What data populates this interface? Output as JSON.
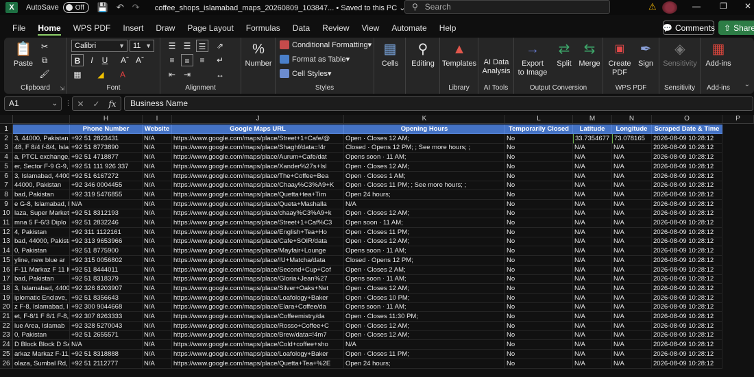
{
  "titlebar": {
    "autosave_label": "AutoSave",
    "toggle_state": "Off",
    "file_name": "coffee_shops_islamabad_maps_20260809_103847...",
    "save_status": "Saved to this PC",
    "search_placeholder": "Search"
  },
  "tabs": [
    "File",
    "Home",
    "WPS PDF",
    "Insert",
    "Draw",
    "Page Layout",
    "Formulas",
    "Data",
    "Review",
    "View",
    "Automate",
    "Help"
  ],
  "active_tab": "Home",
  "buttons": {
    "comments": "Comments",
    "share": "Share"
  },
  "ribbon": {
    "clipboard": {
      "name": "Clipboard",
      "paste": "Paste"
    },
    "font": {
      "name": "Font",
      "family": "Calibri",
      "size": "11"
    },
    "alignment": {
      "name": "Alignment"
    },
    "number": {
      "label": "Number",
      "symbol": "%"
    },
    "styles": {
      "name": "Styles",
      "conditional": "Conditional Formatting",
      "format_table": "Format as Table",
      "cell_styles": "Cell Styles"
    },
    "cells": {
      "label": "Cells"
    },
    "editing": {
      "label": "Editing"
    },
    "library": {
      "name": "Library",
      "templates": "Templates"
    },
    "ai_tools": {
      "name": "AI Tools",
      "ai_data_1": "AI Data",
      "ai_data_2": "Analysis"
    },
    "output": {
      "name": "Output Conversion",
      "export_1": "Export",
      "export_2": "to Image",
      "split": "Split",
      "merge": "Merge"
    },
    "wps_pdf": {
      "name": "WPS PDF",
      "create_1": "Create",
      "create_2": "PDF",
      "sign": "Sign"
    },
    "sensitivity": {
      "name": "Sensitivity",
      "label": "Sensitivity"
    },
    "addins": {
      "name": "Add-ins",
      "label": "Add-ins"
    }
  },
  "formula_bar": {
    "cell_ref": "A1",
    "content": "Business Name"
  },
  "columns": [
    "H",
    "I",
    "J",
    "K",
    "L",
    "M",
    "N",
    "O",
    "P"
  ],
  "headers": [
    "Phone Number",
    "Website",
    "Google Maps URL",
    "Opening Hours",
    "Temporarily Closed",
    "Latitude",
    "Longitude",
    "Scraped Date & Time"
  ],
  "rows": [
    {
      "n": "1"
    },
    {
      "n": "2",
      "g": "3, 44000, Pakistan",
      "h": "+92 51 2823431",
      "i": "N/A",
      "j": "https://www.google.com/maps/place/Street+1+Cafe/@",
      "k": "Open · Closes 12 AM;",
      "l": "No",
      "m": "33.7354677",
      "nv": "73.078165",
      "o": "2026-08-09 10:28:12"
    },
    {
      "n": "3",
      "g": "48, F 8/4 f-8/4, Isla",
      "h": "+92 51 8773890",
      "i": "N/A",
      "j": "https://www.google.com/maps/place/Shaghf/data=!4r",
      "k": "Closed · Opens 12 PM; ; See more hours; ;",
      "l": "No",
      "m": "N/A",
      "nv": "N/A",
      "o": "2026-08-09 10:28:12"
    },
    {
      "n": "4",
      "g": "a, PTCL exchange, S",
      "h": "+92 51 4718877",
      "i": "N/A",
      "j": "https://www.google.com/maps/place/Aurum+Cafe/dat",
      "k": "Opens soon · 11 AM;",
      "l": "No",
      "m": "N/A",
      "nv": "N/A",
      "o": "2026-08-09 10:28:12"
    },
    {
      "n": "5",
      "g": "er, Sector F-9 G-9, I",
      "h": "+92 51 111 926 337",
      "i": "N/A",
      "j": "https://www.google.com/maps/place/Xander%27s+Isl",
      "k": "Open · Closes 12 AM;",
      "l": "No",
      "m": "N/A",
      "nv": "N/A",
      "o": "2026-08-09 10:28:12"
    },
    {
      "n": "6",
      "g": "3, Islamabad, 4400",
      "h": "+92 51 6167272",
      "i": "N/A",
      "j": "https://www.google.com/maps/place/The+Coffee+Bea",
      "k": "Open · Closes 1 AM;",
      "l": "No",
      "m": "N/A",
      "nv": "N/A",
      "o": "2026-08-09 10:28:12"
    },
    {
      "n": "7",
      "g": "44000, Pakistan",
      "h": "+92 346 0004455",
      "i": "N/A",
      "j": "https://www.google.com/maps/place/Chaay%C3%A9+K",
      "k": "Open · Closes 11 PM; ; See more hours; ;",
      "l": "No",
      "m": "N/A",
      "nv": "N/A",
      "o": "2026-08-09 10:28:12"
    },
    {
      "n": "8",
      "g": "bad, Pakistan",
      "h": "+92 319 5476855",
      "i": "N/A",
      "j": "https://www.google.com/maps/place/Quetta+tea+Tim",
      "k": "Open 24 hours;",
      "l": "No",
      "m": "N/A",
      "nv": "N/A",
      "o": "2026-08-09 10:28:12"
    },
    {
      "n": "9",
      "g": "e G-8, Islamabad, F",
      "h": "N/A",
      "i": "N/A",
      "j": "https://www.google.com/maps/place/Queta+Mashalla",
      "k": "N/A",
      "l": "No",
      "m": "N/A",
      "nv": "N/A",
      "o": "2026-08-09 10:28:12"
    },
    {
      "n": "10",
      "g": "laza, Super Market",
      "h": "+92 51 8312193",
      "i": "N/A",
      "j": "https://www.google.com/maps/place/chaay%C3%A9+k",
      "k": "Open · Closes 12 AM;",
      "l": "No",
      "m": "N/A",
      "nv": "N/A",
      "o": "2026-08-09 10:28:12"
    },
    {
      "n": "11",
      "g": "mna 5 F-6/3 Diplo",
      "h": "+92 51 2832246",
      "i": "N/A",
      "j": "https://www.google.com/maps/place/Street+1+Caf%C3",
      "k": "Open soon · 11 AM;",
      "l": "No",
      "m": "N/A",
      "nv": "N/A",
      "o": "2026-08-09 10:28:12"
    },
    {
      "n": "12",
      "g": "4, Pakistan",
      "h": "+92 311 1122161",
      "i": "N/A",
      "j": "https://www.google.com/maps/place/English+Tea+Ho",
      "k": "Open · Closes 11 PM;",
      "l": "No",
      "m": "N/A",
      "nv": "N/A",
      "o": "2026-08-09 10:28:12"
    },
    {
      "n": "13",
      "g": "bad, 44000, Pakista",
      "h": "+92 313 9653966",
      "i": "N/A",
      "j": "https://www.google.com/maps/place/Cafe+SOIR/data",
      "k": "Open · Closes 12 AM;",
      "l": "No",
      "m": "N/A",
      "nv": "N/A",
      "o": "2026-08-09 10:28:12"
    },
    {
      "n": "14",
      "g": "0, Pakistan",
      "h": "+92 51 8775900",
      "i": "N/A",
      "j": "https://www.google.com/maps/place/Mayfair+Lounge",
      "k": "Opens soon · 11 AM;",
      "l": "No",
      "m": "N/A",
      "nv": "N/A",
      "o": "2026-08-09 10:28:12"
    },
    {
      "n": "15",
      "g": "yline, new blue ar",
      "h": "+92 315 0056802",
      "i": "N/A",
      "j": "https://www.google.com/maps/place/IU+Matcha/data",
      "k": "Closed · Opens 12 PM;",
      "l": "No",
      "m": "N/A",
      "nv": "N/A",
      "o": "2026-08-09 10:28:12"
    },
    {
      "n": "16",
      "g": "F-11 Markaz F 11 M",
      "h": "+92 51 8444011",
      "i": "N/A",
      "j": "https://www.google.com/maps/place/Second+Cup+Cof",
      "k": "Open · Closes 2 AM;",
      "l": "No",
      "m": "N/A",
      "nv": "N/A",
      "o": "2026-08-09 10:28:12"
    },
    {
      "n": "17",
      "g": "bad, Pakistan",
      "h": "+92 51 8318379",
      "i": "N/A",
      "j": "https://www.google.com/maps/place/Gloria+Jean%27",
      "k": "Opens soon · 11 AM;",
      "l": "No",
      "m": "N/A",
      "nv": "N/A",
      "o": "2026-08-09 10:28:12"
    },
    {
      "n": "18",
      "g": "3, Islamabad, 4400",
      "h": "+92 326 8203907",
      "i": "N/A",
      "j": "https://www.google.com/maps/place/Silver+Oaks+Net",
      "k": "Open · Closes 12 AM;",
      "l": "No",
      "m": "N/A",
      "nv": "N/A",
      "o": "2026-08-09 10:28:12"
    },
    {
      "n": "19",
      "g": "iplomatic Enclave,",
      "h": "+92 51 8356643",
      "i": "N/A",
      "j": "https://www.google.com/maps/place/Loafology+Baker",
      "k": "Open · Closes 10 PM;",
      "l": "No",
      "m": "N/A",
      "nv": "N/A",
      "o": "2026-08-09 10:28:12"
    },
    {
      "n": "20",
      "g": "z F-8, Islamabad, I",
      "h": "+92 300 9044668",
      "i": "N/A",
      "j": "https://www.google.com/maps/place/Elara+Coffee/da",
      "k": "Opens soon · 11 AM;",
      "l": "No",
      "m": "N/A",
      "nv": "N/A",
      "o": "2026-08-09 10:28:12"
    },
    {
      "n": "21",
      "g": "et, F-8/1 F 8/1 F-8, I",
      "h": "+92 307 8263333",
      "i": "N/A",
      "j": "https://www.google.com/maps/place/Coffeemistry/da",
      "k": "Open · Closes 11:30 PM;",
      "l": "No",
      "m": "N/A",
      "nv": "N/A",
      "o": "2026-08-09 10:28:12"
    },
    {
      "n": "22",
      "g": "lue Area, Islamab",
      "h": "+92 328 5270043",
      "i": "N/A",
      "j": "https://www.google.com/maps/place/Rosso+Coffee+C",
      "k": "Open · Closes 12 AM;",
      "l": "No",
      "m": "N/A",
      "nv": "N/A",
      "o": "2026-08-09 10:28:12"
    },
    {
      "n": "23",
      "g": "0, Pakistan",
      "h": "+92 51 2655571",
      "i": "N/A",
      "j": "https://www.google.com/maps/place/Brew/data=!4m7",
      "k": "Open · Closes 12 AM;",
      "l": "No",
      "m": "N/A",
      "nv": "N/A",
      "o": "2026-08-09 10:28:12"
    },
    {
      "n": "24",
      "g": "D Block Block D Sa",
      "h": "N/A",
      "i": "N/A",
      "j": "https://www.google.com/maps/place/Cold+coffee+sho",
      "k": "N/A",
      "l": "No",
      "m": "N/A",
      "nv": "N/A",
      "o": "2026-08-09 10:28:12"
    },
    {
      "n": "25",
      "g": "arkaz Markaz F-11,",
      "h": "+92 51 8318888",
      "i": "N/A",
      "j": "https://www.google.com/maps/place/Loafology+Baker",
      "k": "Open · Closes 11 PM;",
      "l": "No",
      "m": "N/A",
      "nv": "N/A",
      "o": "2026-08-09 10:28:12"
    },
    {
      "n": "26",
      "g": "olaza, Sumbal Rd, I",
      "h": "+92 51 2112777",
      "i": "N/A",
      "j": "https://www.google.com/maps/place/Quetta+Tea+%2E",
      "k": "Open 24 hours;",
      "l": "No",
      "m": "N/A",
      "nv": "N/A",
      "o": "2026-08-09 10:28:12"
    }
  ],
  "colors": {
    "header_blue": "#4472c4",
    "accent_green": "#8fd16a",
    "share_green": "#2d7d46"
  }
}
